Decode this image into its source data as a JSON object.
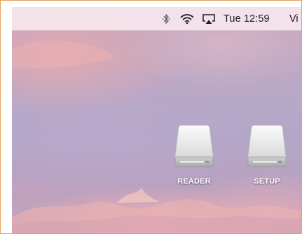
{
  "menubar": {
    "status_icons": [
      "bluetooth-icon",
      "wifi-icon",
      "airplay-icon"
    ],
    "clock": "Tue 12:59",
    "user": "Vi"
  },
  "desktop": {
    "icons": [
      {
        "label": "READER",
        "icon": "external-drive-icon"
      },
      {
        "label": "SETUP",
        "icon": "external-drive-icon"
      }
    ]
  },
  "colors": {
    "frame_border": "#e3a157",
    "menubar_bg": "#f8e8ee"
  }
}
